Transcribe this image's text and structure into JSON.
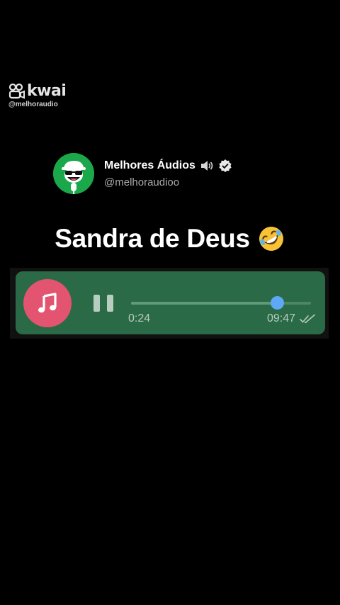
{
  "watermark": {
    "brand": "kwai",
    "handle": "@melhoraudio",
    "icon": "kwai-logo-icon"
  },
  "profile": {
    "name": "Melhores Áudios",
    "handle": "@melhoraudioo",
    "avatar_icon": "singer-microphone-avatar",
    "name_icon": "speaker-icon",
    "verified_icon": "verified-badge-icon",
    "avatar_color": "#1aa84a"
  },
  "title": {
    "text": "Sandra de Deus",
    "emoji": "rolling-on-floor-laughing-emoji"
  },
  "player": {
    "elapsed": "0:24",
    "total": "09:47",
    "progress": 0.81,
    "state": "playing",
    "music_icon": "music-note-icon",
    "control_icon": "pause-icon",
    "status_icon": "double-check-icon",
    "colors": {
      "bubble": "#2b6a46",
      "music_button": "#e2546f",
      "knob": "#5fa8f5"
    }
  }
}
